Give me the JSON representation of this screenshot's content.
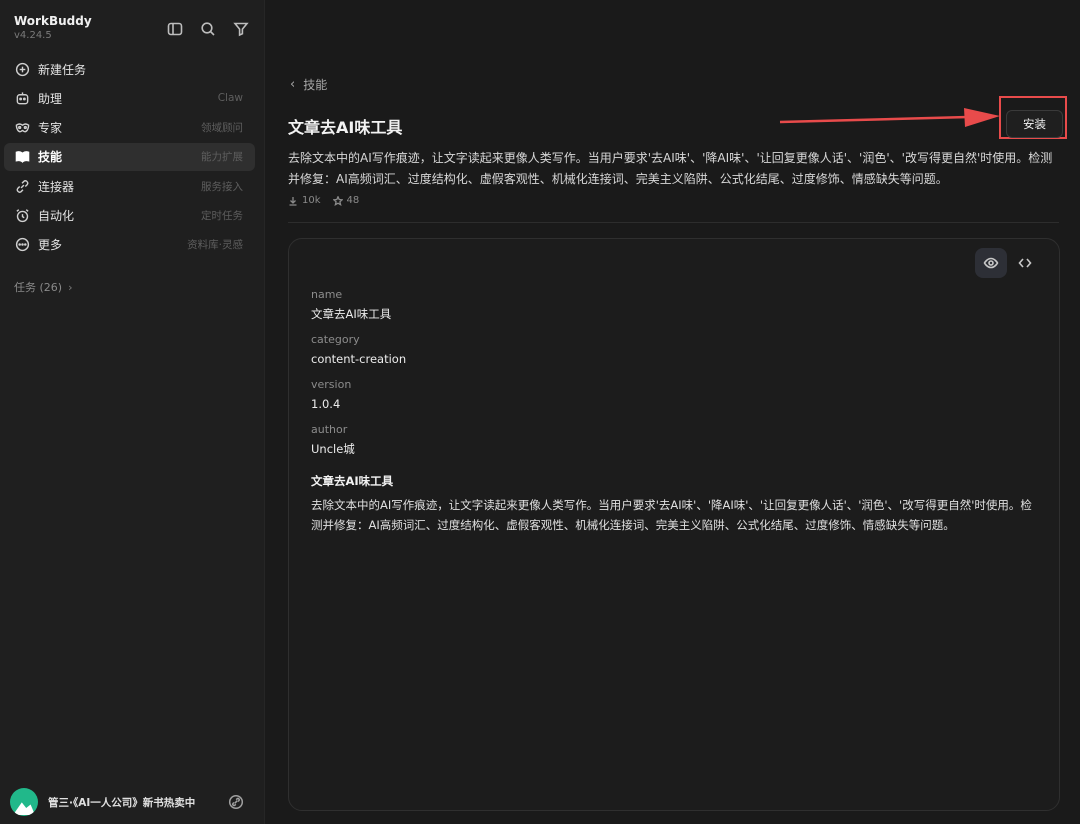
{
  "app": {
    "name": "WorkBuddy",
    "version": "v4.24.5"
  },
  "sidebar": {
    "items": [
      {
        "label": "新建任务",
        "hint": "",
        "icon": "plus-circle-icon"
      },
      {
        "label": "助理",
        "hint": "Claw",
        "icon": "robot-icon"
      },
      {
        "label": "专家",
        "hint": "领域顾问",
        "icon": "mask-icon"
      },
      {
        "label": "技能",
        "hint": "能力扩展",
        "icon": "book-icon"
      },
      {
        "label": "连接器",
        "hint": "服务接入",
        "icon": "link-icon"
      },
      {
        "label": "自动化",
        "hint": "定时任务",
        "icon": "alarm-clock-icon"
      },
      {
        "label": "更多",
        "hint": "资料库·灵感",
        "icon": "more-dots-icon"
      }
    ],
    "tasks_label": "任务 (26)",
    "footer_name": "管三·《AI一人公司》新书热卖中"
  },
  "main": {
    "back_label": "技能",
    "title": "文章去AI味工具",
    "install_label": "安装",
    "description": "去除文本中的AI写作痕迹，让文字读起来更像人类写作。当用户要求'去AI味'、'降AI味'、'让回复更像人话'、'润色'、'改写得更自然'时使用。检测并修复：AI高频词汇、过度结构化、虚假客观性、机械化连接词、完美主义陷阱、公式化结尾、过度修饰、情感缺失等问题。",
    "downloads": "10k",
    "stars": "48",
    "meta": [
      {
        "key": "name",
        "value": "文章去AI味工具"
      },
      {
        "key": "category",
        "value": "content-creation"
      },
      {
        "key": "version",
        "value": "1.0.4"
      },
      {
        "key": "author",
        "value": "Uncle城"
      }
    ],
    "body_title": "文章去AI味工具",
    "body_text": "去除文本中的AI写作痕迹，让文字读起来更像人类写作。当用户要求'去AI味'、'降AI味'、'让回复更像人话'、'润色'、'改写得更自然'时使用。检测并修复：AI高频词汇、过度结构化、虚假客观性、机械化连接词、完美主义陷阱、公式化结尾、过度修饰、情感缺失等问题。"
  },
  "colors": {
    "annotation": "#e84b4b",
    "avatar": "#21b88a"
  }
}
